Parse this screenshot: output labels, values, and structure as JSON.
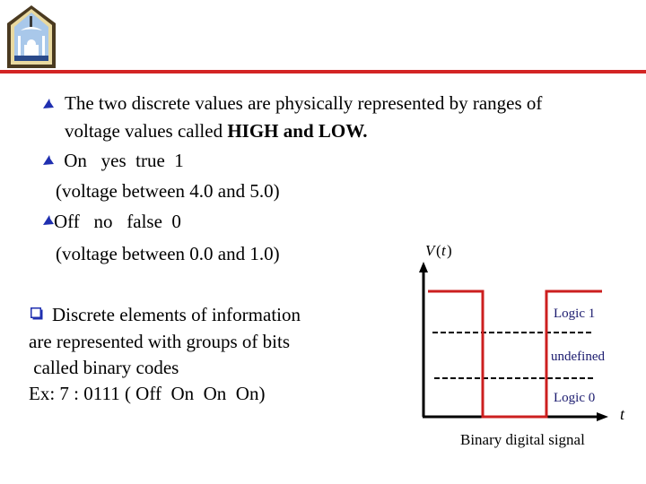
{
  "logo": {
    "icon": "university-crest-icon"
  },
  "bullets": [
    {
      "icon": "arrow-bullet-icon",
      "lines": [
        {
          "text": "The two discrete values are physically represented by ranges of"
        },
        {
          "prefix": "voltage values called ",
          "bold": "HIGH and LOW."
        }
      ]
    },
    {
      "icon": "arrow-bullet-icon",
      "lines": [
        {
          "text": " On   yes  true  1"
        },
        {
          "text": "(voltage between 4.0 and 5.0)"
        }
      ]
    },
    {
      "icon": "arrow-bullet-icon",
      "lines": [
        {
          "text": "Off   no   false  0"
        },
        {
          "text": "(voltage between 0.0 and 1.0)"
        }
      ]
    }
  ],
  "binary_codes": {
    "icon": "checkbox-bullet-icon",
    "lines": [
      "Discrete elements of information",
      "are represented with groups of bits",
      " called binary codes",
      "Ex: 7 : 0111 ( Off  On  On  On)"
    ]
  },
  "diagram": {
    "y_axis_label_v": "V",
    "y_axis_label_paren_open": "(",
    "y_axis_label_t": "t",
    "y_axis_label_paren_close": ")",
    "x_axis_label": "t",
    "region_labels": {
      "logic1": "Logic 1",
      "undefined": "undefined",
      "logic0": "Logic 0"
    },
    "caption": "Binary digital signal",
    "signal_sequence": [
      1,
      0,
      1
    ],
    "colors": {
      "signal": "#cc1f1f",
      "axis": "#000000",
      "threshold": "#000000",
      "region_label": "#1a1a6e",
      "bullet": "#1f2fb0"
    }
  }
}
